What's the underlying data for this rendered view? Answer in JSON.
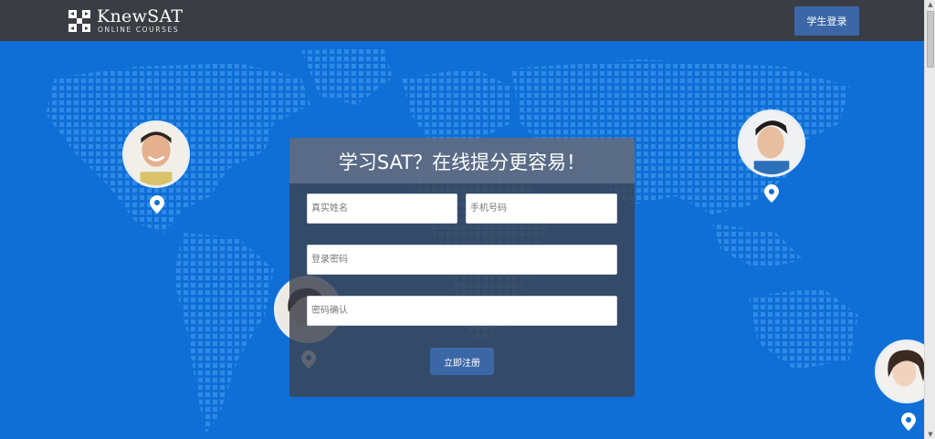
{
  "header": {
    "logo_title": "KnewSAT",
    "logo_subtitle": "ONLINE COURSES",
    "login_button": "学生登录"
  },
  "form": {
    "title": "学习SAT？在线提分更容易！",
    "name_placeholder": "真实姓名",
    "phone_placeholder": "手机号码",
    "password_placeholder": "登录密码",
    "confirm_placeholder": "密码确认",
    "submit_label": "立即注册"
  },
  "colors": {
    "header_bg": "#3a3d43",
    "page_bg": "#0f6fd6",
    "button_bg": "#3b67a6"
  },
  "icons": [
    "logo-icon",
    "location-pin-icon",
    "avatar"
  ]
}
